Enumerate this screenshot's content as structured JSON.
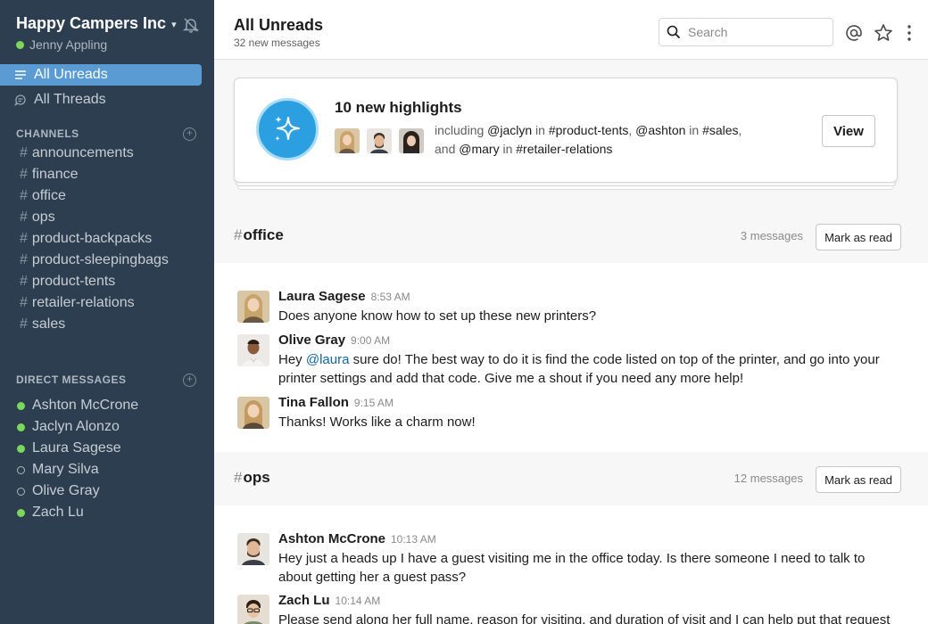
{
  "sidebar": {
    "team_name": "Happy Campers Inc",
    "user_name": "Jenny Appling",
    "nav": [
      {
        "label": "All Unreads",
        "active": true
      },
      {
        "label": "All Threads",
        "active": false
      }
    ],
    "channels_header": "CHANNELS",
    "channels": [
      "announcements",
      "finance",
      "office",
      "ops",
      "product-backpacks",
      "product-sleepingbags",
      "product-tents",
      "retailer-relations",
      "sales"
    ],
    "dm_header": "DIRECT MESSAGES",
    "dms": [
      {
        "name": "Ashton McCrone",
        "online": true
      },
      {
        "name": "Jaclyn Alonzo",
        "online": true
      },
      {
        "name": "Laura Sagese",
        "online": true
      },
      {
        "name": "Mary Silva",
        "online": false
      },
      {
        "name": "Olive Gray",
        "online": false
      },
      {
        "name": "Zach Lu",
        "online": true
      }
    ]
  },
  "header": {
    "title": "All Unreads",
    "subtitle": "32 new messages",
    "search_placeholder": "Search"
  },
  "highlights": {
    "title": "10 new highlights",
    "line1": [
      "including ",
      "@jaclyn",
      " in ",
      "#product-tents",
      ", ",
      "@ashton",
      " in ",
      "#sales",
      ","
    ],
    "line2": [
      "and ",
      "@mary",
      " in ",
      "#retailer-relations"
    ],
    "view_label": "View"
  },
  "sections": [
    {
      "channel": "office",
      "count": "3 messages",
      "mark_label": "Mark as read",
      "messages": [
        {
          "name": "Laura Sagese",
          "time": "8:53 AM",
          "text": "Does anyone know how to set up these new printers?"
        },
        {
          "name": "Olive Gray",
          "time": "9:00 AM",
          "mention": "@laura",
          "text": " sure do! The best way to do it is find the code listed on top of the printer, and go into your printer settings and add that code. Give me a shout if you need any more help!",
          "prefix": "Hey "
        },
        {
          "name": "Tina Fallon",
          "time": "9:15 AM",
          "text": "Thanks! Works like a charm now!"
        }
      ]
    },
    {
      "channel": "ops",
      "count": "12 messages",
      "mark_label": "Mark as read",
      "messages": [
        {
          "name": "Ashton McCrone",
          "time": "10:13 AM",
          "text": "Hey just a heads up I have a guest visiting me in the office today. Is there someone I need to talk to about getting her a guest pass?"
        },
        {
          "name": "Zach Lu",
          "time": "10:14 AM",
          "text": "Please send along her full name, reason for visiting, and duration of visit and I can help put that request"
        }
      ]
    }
  ],
  "colors": {
    "sidebar_bg": "#2c3e50",
    "active_bg": "#5a9bd3",
    "online": "#7bd85a",
    "mention": "#1264a3",
    "highlight_icon": "#2b9fe0"
  }
}
